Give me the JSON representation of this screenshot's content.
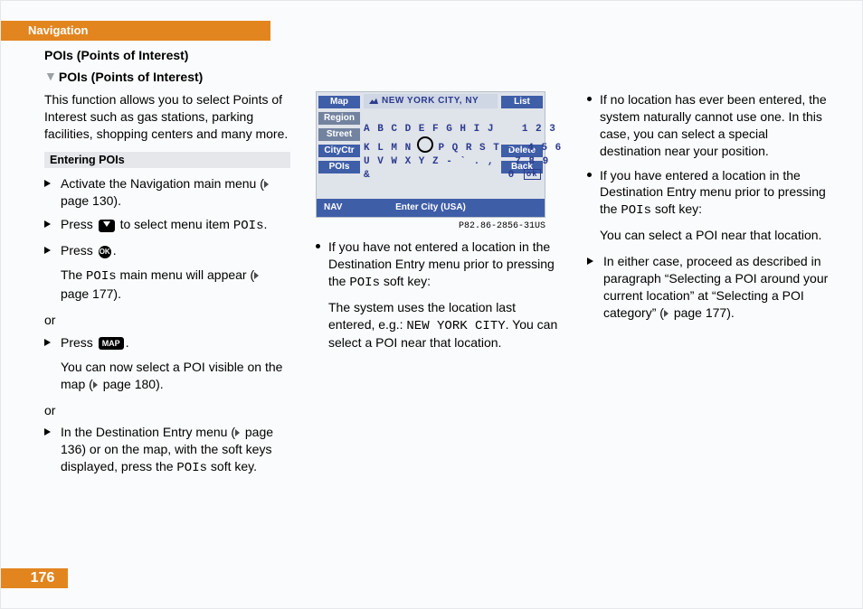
{
  "page_number": "176",
  "section_tab": "Navigation",
  "heading_primary": "POIs (Points of Interest)",
  "heading_secondary": "POIs (Points of Interest)",
  "col1": {
    "intro": "This function allows you to select  Points of Interest such as gas stations, parking facilities, shopping centers and many more.",
    "subhead": "Entering POIs",
    "steps_a": {
      "s1": "Activate the Navigation main menu (",
      "s1_ref": "page 130",
      "s1_end": ").",
      "s2_a": "Press ",
      "s2_b": " to select menu item ",
      "s2_code": "POIs",
      "s2_c": ".",
      "s3_a": "Press ",
      "s3_b": ".",
      "s3_follow_a": "The ",
      "s3_follow_code": "POIs",
      "s3_follow_b": " main menu will appear (",
      "s3_follow_ref": "page 177",
      "s3_follow_c": ")."
    },
    "or1": "or",
    "steps_b": {
      "s1_a": "Press ",
      "s1_b": ".",
      "s1_follow_a": "You can now select a POI visible on the map (",
      "s1_follow_ref": "page 180",
      "s1_follow_b": ")."
    },
    "or2": "or",
    "steps_c": {
      "s1_a": "In the Destination Entry menu (",
      "s1_ref": "page 136",
      "s1_b": ") or on the map, with the soft keys displayed, press the ",
      "s1_code": "POIs",
      "s1_c": " soft key."
    }
  },
  "device": {
    "left_keys": [
      "Map",
      "Region",
      "Street",
      "CityCtr",
      "POIs"
    ],
    "right_keys": {
      "r1": "List",
      "r4": "Delete",
      "r5": "Back"
    },
    "title": "NEW YORK CITY, NY",
    "kbd_line1": "A B C D E F G H I J    1 2 3",
    "kbd_line2a": "K L M N",
    "kbd_line2b": "P Q R S T -  4 5 6",
    "kbd_line3": "U V W X Y Z - ` . ,   7 8 9",
    "kbd_line4a": "&",
    "kbd_line4b": "0",
    "kbd_ok": "ok",
    "bottom_left": "NAV",
    "bottom_mid": "Enter City (USA)",
    "caption": "P82.86-2856-31US"
  },
  "col2": {
    "b1_a": "If you have not entered a location in the Destination Entry menu prior to pressing the ",
    "b1_code": "POIs",
    "b1_b": " soft key:",
    "b1_follow_a": "The system uses the location last entered, e.g.: ",
    "b1_follow_code": "NEW YORK CITY",
    "b1_follow_b": ". You can select a POI near that location."
  },
  "col3": {
    "b1": "If no location has ever been entered, the system naturally cannot use one. In this case, you can select a special destination near your position.",
    "b2_a": "If you have entered a location in the Destination Entry menu prior to pressing the ",
    "b2_code": "POIs",
    "b2_b": " soft key:",
    "b2_follow": "You can select a POI near that location.",
    "s1_a": "In either case, proceed as described in paragraph “Selecting a POI around your current location” at “Selecting a POI category” (",
    "s1_ref": "page 177",
    "s1_b": ")."
  },
  "keys": {
    "down": "▼",
    "ok": "OK",
    "map": "MAP"
  }
}
